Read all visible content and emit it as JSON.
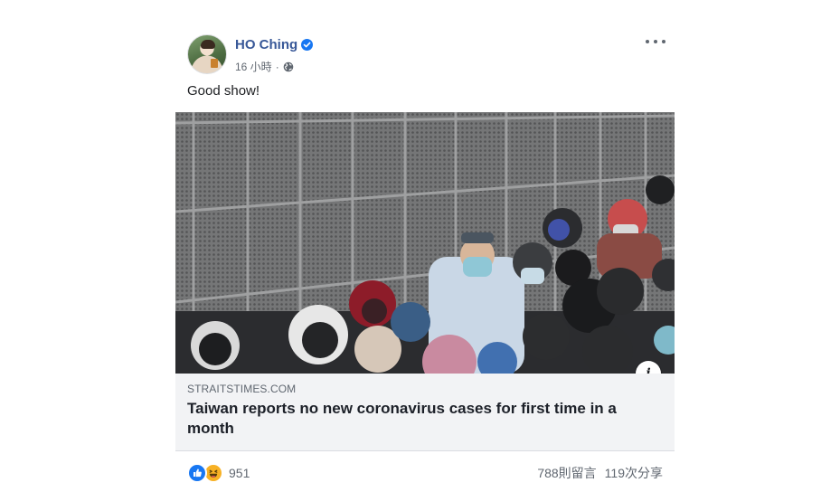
{
  "post": {
    "author": "HO Ching",
    "time": "16 小時",
    "separator": "·",
    "caption": "Good show!",
    "link": {
      "domain": "STRAITSTIMES.COM",
      "headline": "Taiwan reports no new coronavirus cases for first time in a month",
      "info_label": "i"
    },
    "reaction_count": "951",
    "comments": "788則留言",
    "shares": "119次分享"
  },
  "icons": {
    "verified": "verified-badge-icon",
    "privacy": "globe-icon",
    "menu": "more-options-icon",
    "reactions": [
      "like-icon",
      "haha-icon"
    ]
  },
  "colors": {
    "author_link": "#385898",
    "verified": "#1877f2",
    "like": "#1877f2",
    "haha": "#f7b125",
    "card_bg": "#f2f3f5"
  }
}
